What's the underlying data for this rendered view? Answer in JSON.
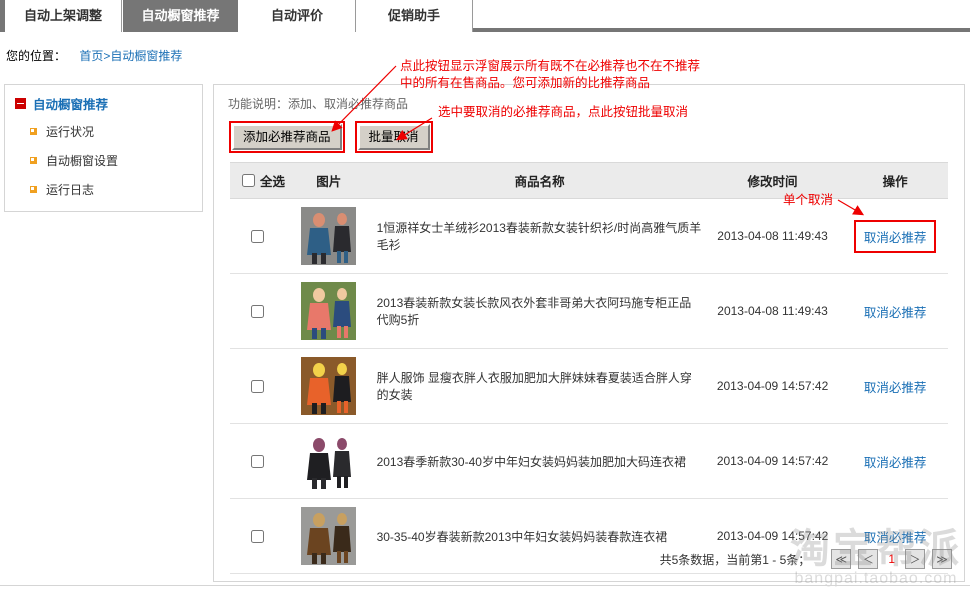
{
  "tabs": [
    {
      "label": "自动上架调整",
      "active": false
    },
    {
      "label": "自动橱窗推荐",
      "active": true
    },
    {
      "label": "自动评价",
      "active": false
    },
    {
      "label": "促销助手",
      "active": false
    }
  ],
  "breadcrumb": {
    "label": "您的位置：",
    "home": "首页",
    "sep": ">",
    "current": "自动橱窗推荐"
  },
  "sidebar": {
    "title": "自动橱窗推荐",
    "items": [
      {
        "label": "运行状况"
      },
      {
        "label": "自动橱窗设置"
      },
      {
        "label": "运行日志"
      }
    ]
  },
  "panel": {
    "func_desc": "功能说明：添加、取消必推荐商品",
    "buttons": {
      "add": "添加必推荐商品",
      "batch_cancel": "批量取消"
    }
  },
  "table": {
    "headers": {
      "select_all": "全选",
      "image": "图片",
      "name": "商品名称",
      "time": "修改时间",
      "action": "操作"
    },
    "action_label": "取消必推荐",
    "rows": [
      {
        "name": "1恒源祥女士羊绒衫2013春装新款女装针织衫/时尚高雅气质羊毛衫",
        "time": "2013-04-08 11:49:43",
        "action": "取消必推荐",
        "checked": false,
        "thumb": "woman-blue-knit-dress"
      },
      {
        "name": "2013春装新款女装长款风衣外套非哥弟大衣阿玛施专柜正品代购5折",
        "time": "2013-04-08 11:49:43",
        "action": "取消必推荐",
        "checked": false,
        "thumb": "woman-pink-trench-coat"
      },
      {
        "name": "胖人服饰 显瘦衣胖人衣服加肥加大胖妹妹春夏装适合胖人穿的女装",
        "time": "2013-04-09 14:57:42",
        "action": "取消必推荐",
        "checked": false,
        "thumb": "plus-size-black-outfit"
      },
      {
        "name": "2013春季新款30-40岁中年妇女装妈妈装加肥加大码连衣裙",
        "time": "2013-04-09 14:57:42",
        "action": "取消必推荐",
        "checked": false,
        "thumb": "two-women-black-dresses"
      },
      {
        "name": "30-35-40岁春装新款2013中年妇女装妈妈装春款连衣裙",
        "time": "2013-04-09 14:57:42",
        "action": "取消必推荐",
        "checked": false,
        "thumb": "woman-floral-dress"
      }
    ]
  },
  "pager": {
    "info": "共5条数据，当前第1 - 5条；",
    "first": "≪",
    "prev": "＜",
    "current": "1",
    "next": "＞",
    "last": "≫"
  },
  "annotations": {
    "top": "点此按钮显示浮窗展示所有既不在必推荐也不在不推荐",
    "top2": "中的所有在售商品。您可添加新的比推荐商品",
    "mid": "选中要取消的必推荐商品，点此按钮批量取消",
    "single": "单个取消"
  },
  "watermark": {
    "main": "淘宝帮派",
    "sub": "bangpai.taobao.com"
  },
  "colors": {
    "tabbar_bg": "#767676",
    "link_blue": "#1a6fb5",
    "annotation_red": "#ee0000",
    "header_bg": "#ebebeb",
    "sidebar_bullet": "#f0a020"
  }
}
